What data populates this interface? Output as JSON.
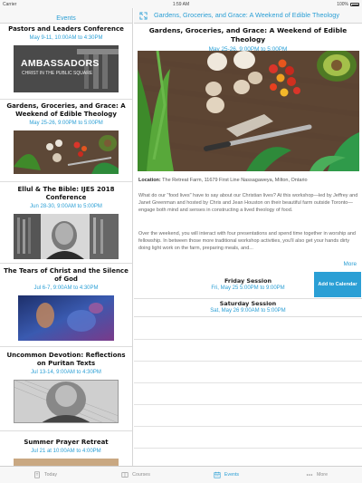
{
  "status_bar": {
    "carrier": "Carrier",
    "time": "1:59 AM",
    "battery": "100%"
  },
  "nav": {
    "left_title": "Events",
    "right_title": "Gardens, Groceries, and Grace: A Weekend of Edible Theology"
  },
  "events": [
    {
      "title": "Pastors and Leaders Conference",
      "date": "May 9-11, 10:00AM to 4:30PM",
      "thumb_text_1": "AMBASSADORS",
      "thumb_text_2": "CHRIST IN THE PUBLIC SQUARE"
    },
    {
      "title": "Gardens, Groceries, and Grace: A Weekend of Edible Theology",
      "date": "May 25-26, 9:00PM to 5:00PM"
    },
    {
      "title": "Ellul & The Bible: IJES 2018 Conference",
      "date": "Jun 28-30, 9:00AM to 5:00PM"
    },
    {
      "title": "The Tears of Christ and the Silence of God",
      "date": "Jul 6-7, 9:00AM to 4:30PM"
    },
    {
      "title": "Uncommon Devotion: Reflections on Puritan Texts",
      "date": "Jul 13-14, 9:00AM to 4:30PM"
    },
    {
      "title": "Summer Prayer Retreat",
      "date": "Jul 21 at 10:00AM to 4:00PM"
    }
  ],
  "detail": {
    "title": "Gardens, Groceries, and Grace: A Weekend of Edible Theology",
    "date": "May 25-26, 9:00PM to 5:00PM",
    "location_label": "Location:",
    "location": " The Retreat Farm, 11679 First Line Nassagaweya, Milton, Ontario",
    "para1": "What do our \"food lives\" have to say about our Christian lives? At this workshop—led by Jeffrey and Janet Greenman and hosted by Chris and Jean Houston on their beautiful farm outside Toronto—engage both mind and senses in constructing a lived theology of food.",
    "para2": "Over the weekend, you will interact with four presentations and spend time together in worship and fellowship. In between those more traditional workshop activities, you'll also get your hands dirty doing light work on the farm, preparing meals, and...",
    "more": "More",
    "add_to_calendar": "Add to Calendar",
    "sessions": [
      {
        "name": "Friday Session",
        "time": "Fri, May 25 5:00PM to 9:00PM"
      },
      {
        "name": "Saturday Session",
        "time": "Sat, May 26 9:00AM to 5:00PM"
      }
    ]
  },
  "tabs": [
    {
      "label": "Today",
      "icon": "book-icon"
    },
    {
      "label": "Courses",
      "icon": "courses-icon"
    },
    {
      "label": "Events",
      "icon": "calendar-icon"
    },
    {
      "label": "More",
      "icon": "more-icon"
    }
  ],
  "colors": {
    "accent": "#2b9fd5",
    "bar_bg": "#f7f7f7"
  }
}
